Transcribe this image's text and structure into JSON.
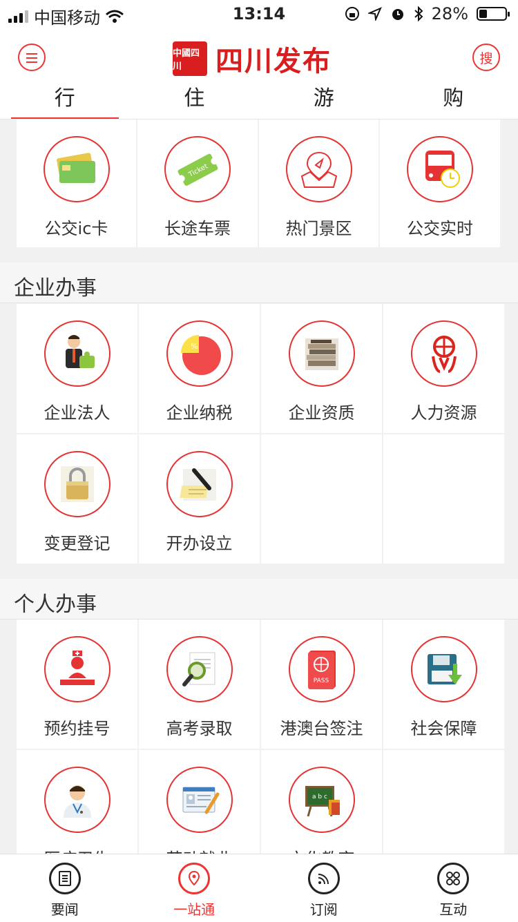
{
  "status_bar": {
    "carrier": "中国移动",
    "time": "13:14",
    "battery": "28%"
  },
  "header": {
    "title": "四川发布",
    "seal_text": "中國四川",
    "search_label": "搜"
  },
  "tabs": [
    "行",
    "住",
    "游",
    "购"
  ],
  "travel_items": [
    {
      "label": "公交ic卡",
      "icon": "bus-card-icon"
    },
    {
      "label": "长途车票",
      "icon": "ticket-icon"
    },
    {
      "label": "热门景区",
      "icon": "map-location-icon"
    },
    {
      "label": "公交实时",
      "icon": "bus-clock-icon"
    }
  ],
  "section_enterprise": {
    "title": "企业办事",
    "items": [
      {
        "label": "企业法人",
        "icon": "businessman-puzzle-icon"
      },
      {
        "label": "企业纳税",
        "icon": "tax-pie-icon"
      },
      {
        "label": "企业资质",
        "icon": "books-stack-icon"
      },
      {
        "label": "人力资源",
        "icon": "globe-person-icon"
      },
      {
        "label": "变更登记",
        "icon": "padlock-icon"
      },
      {
        "label": "开办设立",
        "icon": "pen-notepad-icon"
      }
    ]
  },
  "section_personal": {
    "title": "个人办事",
    "items": [
      {
        "label": "预约挂号",
        "icon": "nurse-icon"
      },
      {
        "label": "高考录取",
        "icon": "magnifier-document-icon"
      },
      {
        "label": "港澳台签注",
        "icon": "passport-icon",
        "badge": "PASS"
      },
      {
        "label": "社会保障",
        "icon": "floppy-download-icon"
      },
      {
        "label": "医疗卫生",
        "icon": "doctor-icon"
      },
      {
        "label": "劳动就业",
        "icon": "resume-card-icon"
      },
      {
        "label": "文化教育",
        "icon": "blackboard-icon",
        "board_text": "a b c"
      }
    ]
  },
  "bottom_nav": [
    {
      "label": "要闻",
      "icon": "news-icon"
    },
    {
      "label": "一站通",
      "icon": "location-icon",
      "active": true
    },
    {
      "label": "订阅",
      "icon": "rss-icon"
    },
    {
      "label": "互动",
      "icon": "grid-icon"
    }
  ],
  "colors": {
    "accent": "#e53333",
    "brand": "#d81e1e"
  }
}
